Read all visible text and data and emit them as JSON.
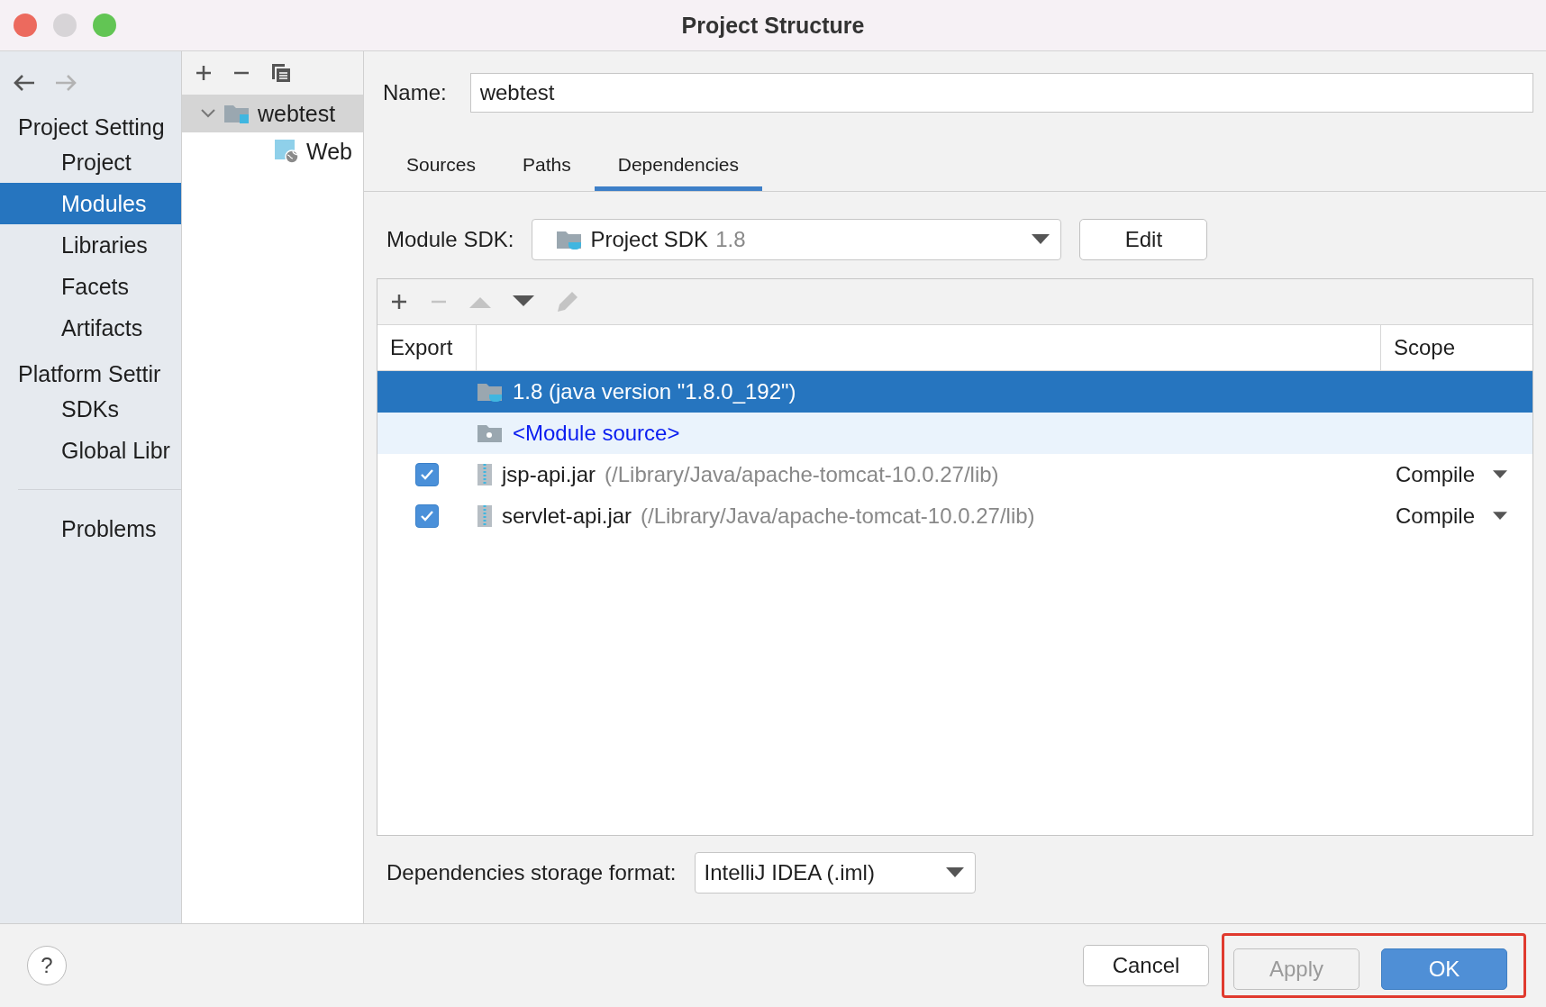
{
  "window": {
    "title": "Project Structure"
  },
  "nav": [
    {
      "kind": "back",
      "disabled": false
    },
    {
      "kind": "forward",
      "disabled": true
    }
  ],
  "sidebar": {
    "sections": [
      {
        "title": "Project Setting",
        "items": [
          {
            "label": "Project",
            "selected": false
          },
          {
            "label": "Modules",
            "selected": true
          },
          {
            "label": "Libraries",
            "selected": false
          },
          {
            "label": "Facets",
            "selected": false
          },
          {
            "label": "Artifacts",
            "selected": false
          }
        ]
      },
      {
        "title": "Platform Settir",
        "items": [
          {
            "label": "SDKs",
            "selected": false
          },
          {
            "label": "Global Libr",
            "selected": false
          }
        ]
      }
    ],
    "bottom_items": [
      {
        "label": "Problems",
        "selected": false
      }
    ]
  },
  "modules": {
    "toolbar": [
      {
        "kind": "add"
      },
      {
        "kind": "remove"
      },
      {
        "kind": "copy"
      }
    ],
    "tree": [
      {
        "label": "webtest",
        "kind": "module",
        "selected": true,
        "expanded": true,
        "children": [
          {
            "label": "Web",
            "kind": "web",
            "selected": false
          }
        ]
      }
    ]
  },
  "name_field": {
    "label": "Name:",
    "value": "webtest"
  },
  "tabs": [
    {
      "label": "Sources",
      "selected": false
    },
    {
      "label": "Paths",
      "selected": false
    },
    {
      "label": "Dependencies",
      "selected": true
    }
  ],
  "module_sdk": {
    "label": "Module SDK:",
    "value": "Project SDK",
    "version": "1.8",
    "edit_button": "Edit"
  },
  "dependencies": {
    "toolbar": [
      {
        "kind": "add",
        "disabled": false
      },
      {
        "kind": "remove",
        "disabled": true
      },
      {
        "kind": "up",
        "disabled": true
      },
      {
        "kind": "down",
        "disabled": false
      },
      {
        "kind": "edit",
        "disabled": true
      }
    ],
    "columns": [
      "Export",
      "Scope"
    ],
    "rows": [
      {
        "kind": "sdk",
        "name": "1.8 (java version \"1.8.0_192\")",
        "selected": true
      },
      {
        "kind": "source",
        "name": "<Module source>",
        "selected": false
      },
      {
        "kind": "jar",
        "name": "jsp-api.jar",
        "path": "(/Library/Java/apache-tomcat-10.0.27/lib)",
        "checked": true,
        "scope": "Compile",
        "selected": false
      },
      {
        "kind": "jar",
        "name": "servlet-api.jar",
        "path": "(/Library/Java/apache-tomcat-10.0.27/lib)",
        "checked": true,
        "scope": "Compile",
        "selected": false
      }
    ]
  },
  "storage_format": {
    "label": "Dependencies storage format:",
    "value": "IntelliJ IDEA (.iml)"
  },
  "footer": {
    "help": "?",
    "buttons": [
      {
        "label": "Cancel",
        "kind": "normal",
        "disabled": false,
        "highlighted": false
      },
      {
        "label": "Apply",
        "kind": "normal",
        "disabled": true,
        "highlighted": true
      },
      {
        "label": "OK",
        "kind": "default",
        "disabled": false,
        "highlighted": true
      }
    ]
  }
}
